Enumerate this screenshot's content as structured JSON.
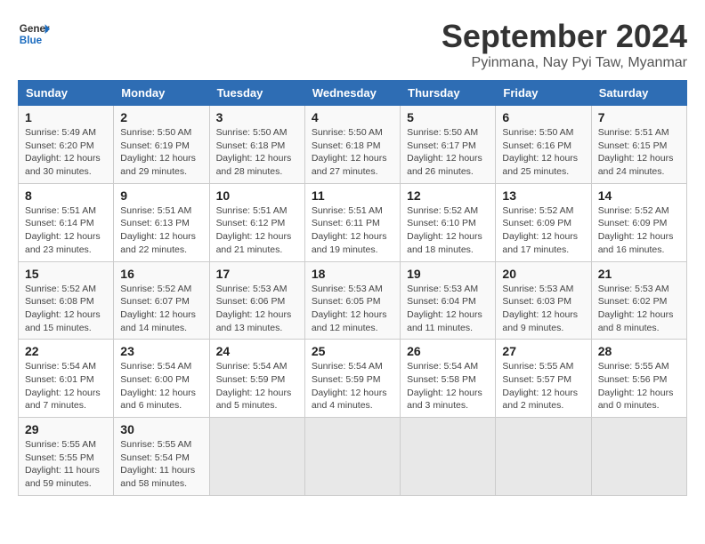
{
  "header": {
    "logo_line1": "General",
    "logo_line2": "Blue",
    "title": "September 2024",
    "subtitle": "Pyinmana, Nay Pyi Taw, Myanmar"
  },
  "columns": [
    "Sunday",
    "Monday",
    "Tuesday",
    "Wednesday",
    "Thursday",
    "Friday",
    "Saturday"
  ],
  "weeks": [
    [
      {
        "day": "1",
        "sunrise": "5:49 AM",
        "sunset": "6:20 PM",
        "daylight": "12 hours and 30 minutes."
      },
      {
        "day": "2",
        "sunrise": "5:50 AM",
        "sunset": "6:19 PM",
        "daylight": "12 hours and 29 minutes."
      },
      {
        "day": "3",
        "sunrise": "5:50 AM",
        "sunset": "6:18 PM",
        "daylight": "12 hours and 28 minutes."
      },
      {
        "day": "4",
        "sunrise": "5:50 AM",
        "sunset": "6:18 PM",
        "daylight": "12 hours and 27 minutes."
      },
      {
        "day": "5",
        "sunrise": "5:50 AM",
        "sunset": "6:17 PM",
        "daylight": "12 hours and 26 minutes."
      },
      {
        "day": "6",
        "sunrise": "5:50 AM",
        "sunset": "6:16 PM",
        "daylight": "12 hours and 25 minutes."
      },
      {
        "day": "7",
        "sunrise": "5:51 AM",
        "sunset": "6:15 PM",
        "daylight": "12 hours and 24 minutes."
      }
    ],
    [
      {
        "day": "8",
        "sunrise": "5:51 AM",
        "sunset": "6:14 PM",
        "daylight": "12 hours and 23 minutes."
      },
      {
        "day": "9",
        "sunrise": "5:51 AM",
        "sunset": "6:13 PM",
        "daylight": "12 hours and 22 minutes."
      },
      {
        "day": "10",
        "sunrise": "5:51 AM",
        "sunset": "6:12 PM",
        "daylight": "12 hours and 21 minutes."
      },
      {
        "day": "11",
        "sunrise": "5:51 AM",
        "sunset": "6:11 PM",
        "daylight": "12 hours and 19 minutes."
      },
      {
        "day": "12",
        "sunrise": "5:52 AM",
        "sunset": "6:10 PM",
        "daylight": "12 hours and 18 minutes."
      },
      {
        "day": "13",
        "sunrise": "5:52 AM",
        "sunset": "6:09 PM",
        "daylight": "12 hours and 17 minutes."
      },
      {
        "day": "14",
        "sunrise": "5:52 AM",
        "sunset": "6:09 PM",
        "daylight": "12 hours and 16 minutes."
      }
    ],
    [
      {
        "day": "15",
        "sunrise": "5:52 AM",
        "sunset": "6:08 PM",
        "daylight": "12 hours and 15 minutes."
      },
      {
        "day": "16",
        "sunrise": "5:52 AM",
        "sunset": "6:07 PM",
        "daylight": "12 hours and 14 minutes."
      },
      {
        "day": "17",
        "sunrise": "5:53 AM",
        "sunset": "6:06 PM",
        "daylight": "12 hours and 13 minutes."
      },
      {
        "day": "18",
        "sunrise": "5:53 AM",
        "sunset": "6:05 PM",
        "daylight": "12 hours and 12 minutes."
      },
      {
        "day": "19",
        "sunrise": "5:53 AM",
        "sunset": "6:04 PM",
        "daylight": "12 hours and 11 minutes."
      },
      {
        "day": "20",
        "sunrise": "5:53 AM",
        "sunset": "6:03 PM",
        "daylight": "12 hours and 9 minutes."
      },
      {
        "day": "21",
        "sunrise": "5:53 AM",
        "sunset": "6:02 PM",
        "daylight": "12 hours and 8 minutes."
      }
    ],
    [
      {
        "day": "22",
        "sunrise": "5:54 AM",
        "sunset": "6:01 PM",
        "daylight": "12 hours and 7 minutes."
      },
      {
        "day": "23",
        "sunrise": "5:54 AM",
        "sunset": "6:00 PM",
        "daylight": "12 hours and 6 minutes."
      },
      {
        "day": "24",
        "sunrise": "5:54 AM",
        "sunset": "5:59 PM",
        "daylight": "12 hours and 5 minutes."
      },
      {
        "day": "25",
        "sunrise": "5:54 AM",
        "sunset": "5:59 PM",
        "daylight": "12 hours and 4 minutes."
      },
      {
        "day": "26",
        "sunrise": "5:54 AM",
        "sunset": "5:58 PM",
        "daylight": "12 hours and 3 minutes."
      },
      {
        "day": "27",
        "sunrise": "5:55 AM",
        "sunset": "5:57 PM",
        "daylight": "12 hours and 2 minutes."
      },
      {
        "day": "28",
        "sunrise": "5:55 AM",
        "sunset": "5:56 PM",
        "daylight": "12 hours and 0 minutes."
      }
    ],
    [
      {
        "day": "29",
        "sunrise": "5:55 AM",
        "sunset": "5:55 PM",
        "daylight": "11 hours and 59 minutes."
      },
      {
        "day": "30",
        "sunrise": "5:55 AM",
        "sunset": "5:54 PM",
        "daylight": "11 hours and 58 minutes."
      },
      null,
      null,
      null,
      null,
      null
    ]
  ]
}
